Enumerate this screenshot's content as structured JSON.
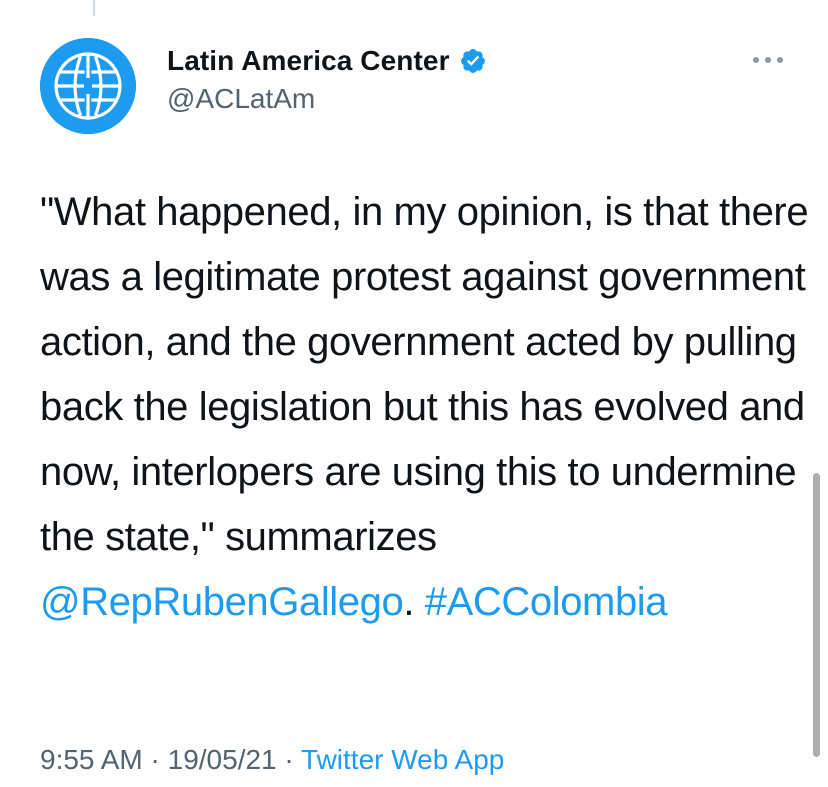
{
  "account": {
    "display_name": "Latin America Center",
    "handle": "@ACLatAm",
    "avatar_icon": "atlantic-council-globe-logo",
    "verified_icon": "verified-badge-icon"
  },
  "tweet": {
    "text_plain": "\"What happened, in my opinion, is that there was a legitimate protest against government action, and the government acted by pulling back the legislation but this has evolved and now, interlopers are using this to undermine the state,\" summarizes ",
    "mention": "@RepRubenGallego",
    "separator": ". ",
    "hashtag": "#ACColombia"
  },
  "meta": {
    "time": "9:55 AM",
    "dot1": " · ",
    "date": "19/05/21",
    "dot2": " · ",
    "source": "Twitter Web App"
  },
  "more_icon": "more-horizontal-icon",
  "colors": {
    "accent": "#1d9bf0",
    "text_primary": "#0f1419",
    "text_secondary": "#536471"
  }
}
